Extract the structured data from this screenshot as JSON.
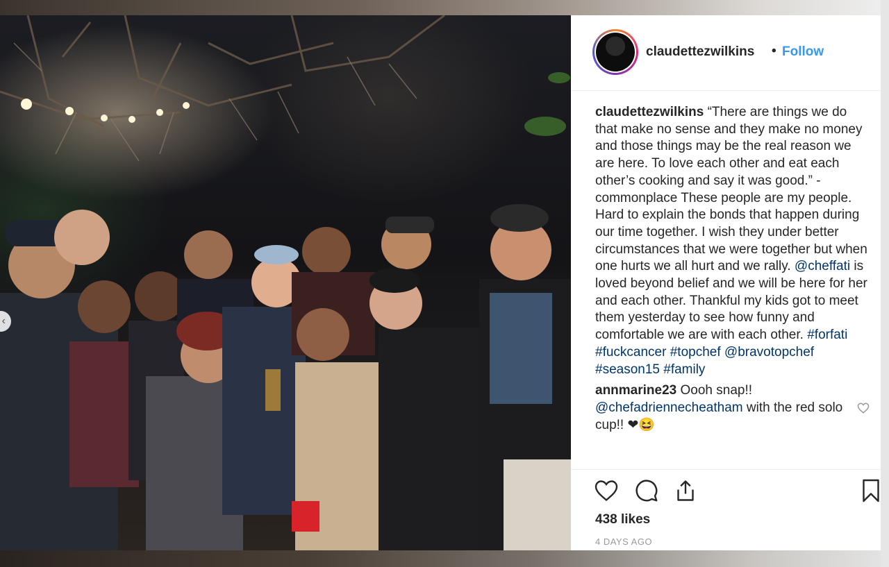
{
  "post": {
    "username": "claudettezwilkins",
    "separator": "•",
    "follow_label": "Follow",
    "caption": {
      "username": "claudettezwilkins",
      "text": "“There are things we do that make no sense and they make no money and those things may be the real reason we are here. To love each other and eat each other’s cooking and say it was good.” -commonplace These people are my people. Hard to explain the bonds that happen during our time together. I wish they under better circumstances that we were together but when one hurts we all hurt and we rally.",
      "mention_1": "@cheffati",
      "text_2": "is loved beyond belief and we will be here for her and each other. Thankful my kids got to meet them yesterday to see how funny and comfortable we are with each other.",
      "tag_1": "#forfati",
      "tag_2": "#fuckcancer",
      "tag_3": "#topchef",
      "mention_2": "@bravotopchef",
      "tag_4": "#season15",
      "tag_5": "#family"
    },
    "comment": {
      "username": "annmarine23",
      "text": "Oooh snap!!",
      "mention": "@chefadriennecheatham",
      "text_2": "with the red solo cup!! ❤😆"
    },
    "likes": "438 likes",
    "timestamp": "4 DAYS AGO"
  },
  "icons": {
    "like": "heart-icon",
    "comment": "comment-icon",
    "share": "share-icon",
    "save": "bookmark-icon",
    "comment_like": "heart-icon",
    "carousel_prev": "chevron-left-icon"
  },
  "colors": {
    "link": "#003569",
    "follow": "#3897f0",
    "text": "#262626",
    "muted": "#999999"
  }
}
